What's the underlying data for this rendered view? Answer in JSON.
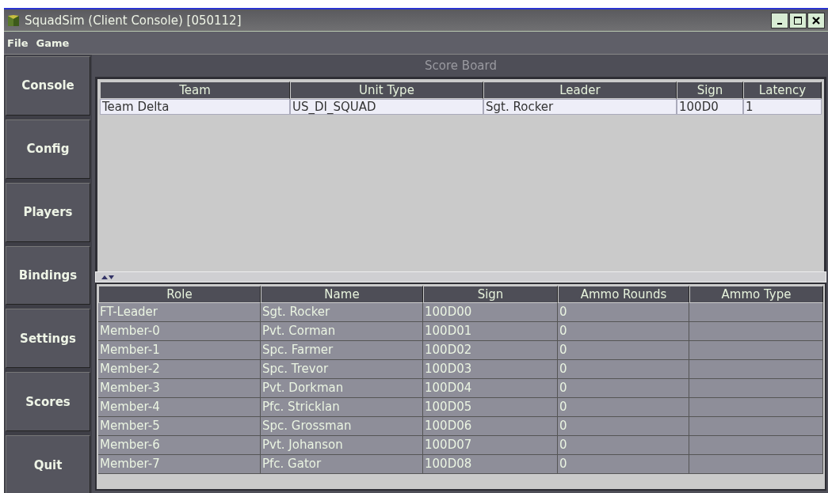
{
  "window": {
    "title": "SquadSim (Client Console) [050112]"
  },
  "menu": [
    "File",
    "Game"
  ],
  "sidebar": {
    "items": [
      "Console",
      "Config",
      "Players",
      "Bindings",
      "Settings",
      "Scores",
      "Quit"
    ]
  },
  "panel": {
    "title": "Score Board"
  },
  "teams_table": {
    "columns": [
      "Team",
      "Unit Type",
      "Leader",
      "Sign",
      "Latency"
    ],
    "rows": [
      {
        "cells": [
          "Team Delta",
          "US_DI_SQUAD",
          "Sgt. Rocker",
          "100D0",
          "1"
        ],
        "selected": true
      }
    ]
  },
  "members_table": {
    "columns": [
      "Role",
      "Name",
      "Sign",
      "Ammo Rounds",
      "Ammo Type"
    ],
    "rows": [
      {
        "cells": [
          "FT-Leader",
          "Sgt. Rocker",
          "100D00",
          "0"
        ]
      },
      {
        "cells": [
          "Member-0",
          "Pvt. Corman",
          "100D01",
          "0"
        ]
      },
      {
        "cells": [
          "Member-1",
          "Spc. Farmer",
          "100D02",
          "0"
        ]
      },
      {
        "cells": [
          "Member-2",
          "Spc. Trevor",
          "100D03",
          "0"
        ]
      },
      {
        "cells": [
          "Member-3",
          "Pvt. Dorkman",
          "100D04",
          "0"
        ]
      },
      {
        "cells": [
          "Member-4",
          "Pfc. Stricklan",
          "100D05",
          "0"
        ]
      },
      {
        "cells": [
          "Member-5",
          "Spc. Grossman",
          "100D06",
          "0"
        ]
      },
      {
        "cells": [
          "Member-6",
          "Pvt. Johanson",
          "100D07",
          "0"
        ]
      },
      {
        "cells": [
          "Member-7",
          "Pfc. Gator",
          "100D08",
          "0"
        ]
      }
    ]
  }
}
